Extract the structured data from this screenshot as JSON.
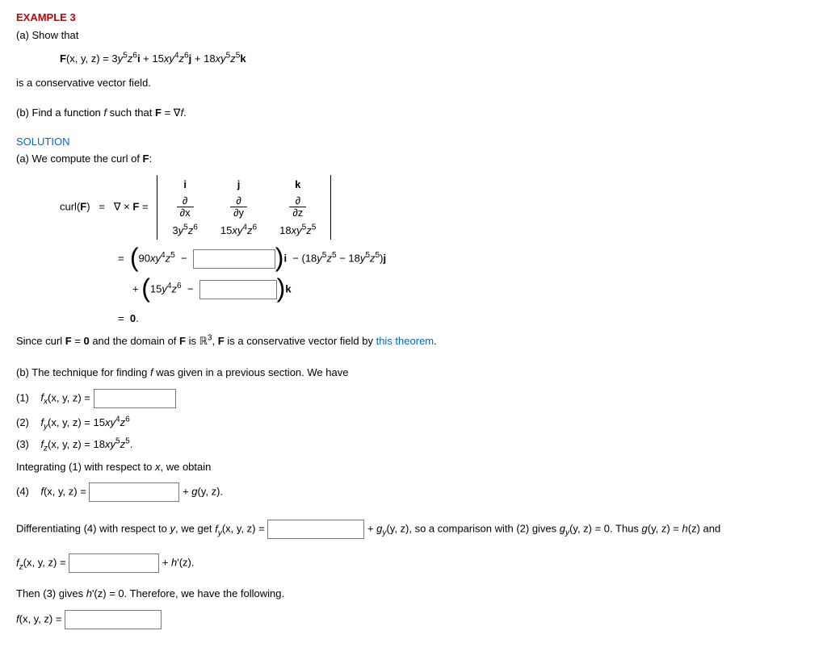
{
  "headings": {
    "example": "EXAMPLE 3",
    "solution": "SOLUTION"
  },
  "part_a_prompt": "(a) Show that",
  "vector_field_eq": {
    "lead": "F",
    "args": "(x, y, z) = ",
    "term1_coef": "3",
    "term2_coef": "15",
    "term3_coef": "18"
  },
  "conservative_line": "is a conservative vector field.",
  "part_b_prompt_a": "(b) Find a function ",
  "part_b_prompt_b": " such that  ",
  "part_b_prompt_c": " = ",
  "sol_a_line": "(a) We compute the curl of ",
  "curl_label": "curl(",
  "curl_label2": ")",
  "eq_sym": "=",
  "nabla_cross": " × ",
  "det": {
    "r1c1": "i",
    "r1c2": "j",
    "r1c3": "k",
    "partial": "∂",
    "dx": "∂x",
    "dy": "∂y",
    "dz": "∂z",
    "r3c1_coef": "3",
    "r3c2_coef": "15",
    "r3c3_coef": "18"
  },
  "line_i": {
    "coef1": "90",
    "j_a": "18",
    "j_b": "18"
  },
  "line_k": {
    "coef1": "15"
  },
  "zero_line": "= ",
  "zero_bold": "0",
  "since_a": "Since curl  ",
  "since_b": " = ",
  "since_c": "  and the domain of ",
  "since_d": " is ",
  "since_e": ", ",
  "since_f": " is a conservative vector field by ",
  "theorem_link": "this theorem",
  "part_b_intro": "(b) The technique for finding ",
  "part_b_intro2": " was given in a previous section. We have",
  "eq1_label": "(1)",
  "eq2_label": "(2)",
  "eq3_label": "(3)",
  "eq4_label": "(4)",
  "fx_lhs": "(x, y, z)  = ",
  "fy_rhs_coef": "15",
  "fz_rhs_coef": "18",
  "integrate_line": "Integrating (1) with respect to ",
  "integrate_line2": ", we obtain",
  "f4_rhs": " + ",
  "f4_rhs_g": "g",
  "f4_rhs_args": "(y, z).",
  "diff_line_a": "Differentiating (4) with respect to ",
  "diff_line_b": ", we get  ",
  "diff_line_c": "(x, y, z) = ",
  "after_blank": " + ",
  "gy": "g",
  "gy_args": "(y, z),  so a comparison with (2) gives  ",
  "gy2_args": "(y, z) = 0.  Thus  ",
  "hz": "g",
  "hz_args": "(y, z) = ",
  "hz2": "h",
  "hz2_args": "(z)  and",
  "fz_line_lhs": "(x, y, z)  = ",
  "fz_line_rhs": "  +  ",
  "hprime": "h",
  "hprime_args": "'(z).",
  "then_line_a": "Then (3) gives  ",
  "then_line_b": "'(z)  =  0.  Therefore, we have the following.",
  "final_lhs": "(x, y, z)  =  ",
  "dot": "."
}
